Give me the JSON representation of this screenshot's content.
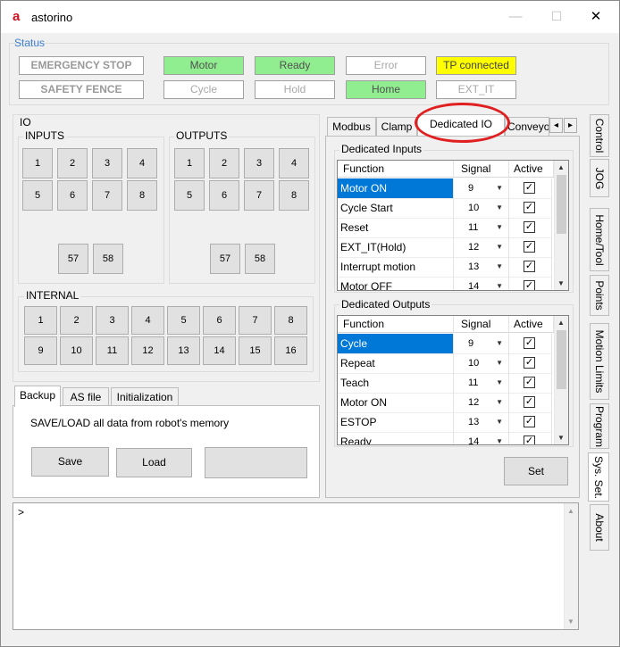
{
  "window": {
    "title": "astorino",
    "logo": "a-logo-icon",
    "minimize": "—",
    "maximize": "☐",
    "close": "✕"
  },
  "status": {
    "legend": "Status",
    "buttons": [
      {
        "label": "EMERGENCY STOP"
      },
      {
        "label": "Motor"
      },
      {
        "label": "Ready"
      },
      {
        "label": "Error"
      },
      {
        "label": "TP connected"
      },
      {
        "label": "SAFETY FENCE"
      },
      {
        "label": "Cycle"
      },
      {
        "label": "Hold"
      },
      {
        "label": "Home"
      },
      {
        "label": "EXT_IT"
      }
    ],
    "colors": {
      "green": "#90ee90",
      "yellow": "#ffff00"
    }
  },
  "io": {
    "legend": "IO",
    "inputs_legend": "INPUTS",
    "outputs_legend": "OUTPUTS",
    "inputs": [
      "1",
      "2",
      "3",
      "4",
      "5",
      "6",
      "7",
      "8",
      "57",
      "58"
    ],
    "outputs": [
      "1",
      "2",
      "3",
      "4",
      "5",
      "6",
      "7",
      "8",
      "57",
      "58"
    ],
    "internal_legend": "INTERNAL",
    "internal": [
      "1",
      "2",
      "3",
      "4",
      "5",
      "6",
      "7",
      "8",
      "9",
      "10",
      "11",
      "12",
      "13",
      "14",
      "15",
      "16"
    ]
  },
  "backup": {
    "tabs": [
      {
        "label": "Backup"
      },
      {
        "label": "AS file"
      },
      {
        "label": "Initialization"
      }
    ],
    "description": "SAVE/LOAD all data from robot's memory",
    "save": "Save",
    "load": "Load",
    "empty": ""
  },
  "settings": {
    "tabs": [
      {
        "label": "Modbus"
      },
      {
        "label": "Clamp"
      },
      {
        "label": "Dedicated IO"
      },
      {
        "label": "Conveyo"
      }
    ],
    "scroll_left": "◂",
    "scroll_right": "▸",
    "inputs_legend": "Dedicated Inputs",
    "outputs_legend": "Dedicated Outputs",
    "columns": {
      "function": "Function",
      "signal": "Signal",
      "active": "Active"
    },
    "dedicated_inputs": [
      {
        "function": "Motor ON",
        "signal": "9",
        "active": true
      },
      {
        "function": "Cycle Start",
        "signal": "10",
        "active": true
      },
      {
        "function": "Reset",
        "signal": "11",
        "active": true
      },
      {
        "function": "EXT_IT(Hold)",
        "signal": "12",
        "active": true
      },
      {
        "function": "Interrupt motion",
        "signal": "13",
        "active": true
      },
      {
        "function": "Motor OFF",
        "signal": "14",
        "active": true
      }
    ],
    "dedicated_outputs": [
      {
        "function": "Cycle",
        "signal": "9",
        "active": true
      },
      {
        "function": "Repeat",
        "signal": "10",
        "active": true
      },
      {
        "function": "Teach",
        "signal": "11",
        "active": true
      },
      {
        "function": "Motor ON",
        "signal": "12",
        "active": true
      },
      {
        "function": "ESTOP",
        "signal": "13",
        "active": true
      },
      {
        "function": "Ready",
        "signal": "14",
        "active": true
      }
    ],
    "set_button": "Set",
    "highlight_color": "#e02020"
  },
  "side_tabs": [
    {
      "label": "Control"
    },
    {
      "label": "JOG"
    },
    {
      "label": "Home/Tool"
    },
    {
      "label": "Points"
    },
    {
      "label": "Motion Limits"
    },
    {
      "label": "Program"
    },
    {
      "label": "Sys. Set."
    },
    {
      "label": "About"
    }
  ],
  "console": {
    "prompt": ">"
  }
}
